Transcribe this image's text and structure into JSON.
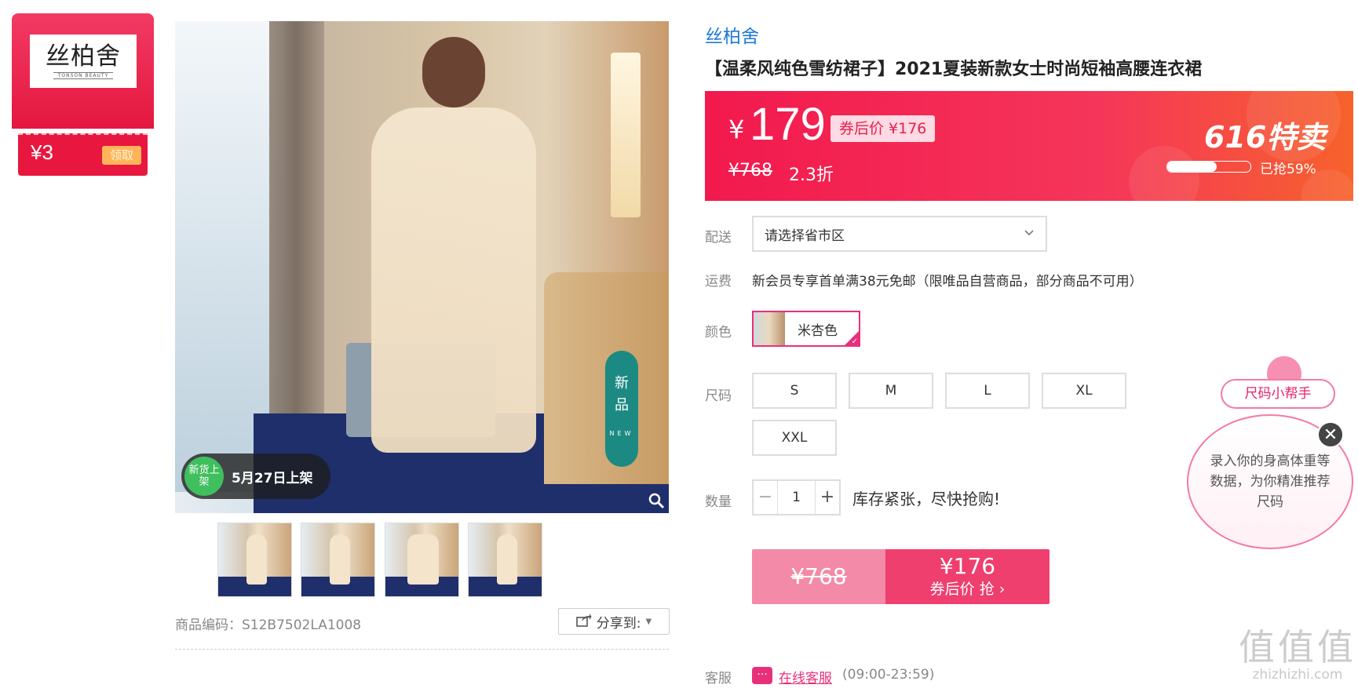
{
  "coupon": {
    "brand_logo": "丝柏舍",
    "brand_logo_sub": "TONSON BEAUTY",
    "amount": "¥3",
    "claim_label": "领取"
  },
  "gallery": {
    "new_badge": "新货上架",
    "new_date": "5月27日上架",
    "new_tag_cn_1": "新",
    "new_tag_cn_2": "品",
    "new_tag_en": "NEW",
    "thumbnails": [
      "thumb-1",
      "thumb-2",
      "thumb-3",
      "thumb-4"
    ]
  },
  "product": {
    "brand": "丝柏舍",
    "title": "【温柔风纯色雪纺裙子】2021夏装新款女士时尚短袖高腰连衣裙",
    "code_label": "商品编码：",
    "code_value": "S12B7502LA1008",
    "share_label": "分享到:"
  },
  "price": {
    "symbol": "¥",
    "current": "179",
    "after_coupon": "券后价 ¥176",
    "original": "¥768",
    "discount": "2.3折",
    "promo_title": "616特卖",
    "sold_text": "已抢59%",
    "sold_fraction": 0.59
  },
  "delivery": {
    "label": "配送",
    "placeholder": "请选择省市区"
  },
  "shipping": {
    "label": "运费",
    "text": "新会员专享首单满38元免邮（限唯品自营商品，部分商品不可用）"
  },
  "color": {
    "label": "颜色",
    "selected": "米杏色"
  },
  "size": {
    "label": "尺码",
    "options": [
      "S",
      "M",
      "L",
      "XL",
      "XXL"
    ]
  },
  "quantity": {
    "label": "数量",
    "value": "1",
    "minus": "−",
    "plus": "+",
    "stock_text": "库存紧张，尽快抢购!"
  },
  "buy": {
    "original": "¥768",
    "price": "¥176",
    "sub_label": "券后价 抢 ›"
  },
  "service": {
    "label": "客服",
    "link": "在线客服",
    "hours": "(09:00-23:59)"
  },
  "size_helper": {
    "title": "尺码小帮手",
    "text": "录入你的身高体重等数据，为你精准推荐尺码",
    "close": "✕"
  },
  "watermark": {
    "main": "值值值",
    "sub": "zhizhizhi.com"
  },
  "colors": {
    "accent_pink": "#e8307a",
    "banner_red": "#f2194d",
    "brand_blue": "#1d7ad6"
  }
}
